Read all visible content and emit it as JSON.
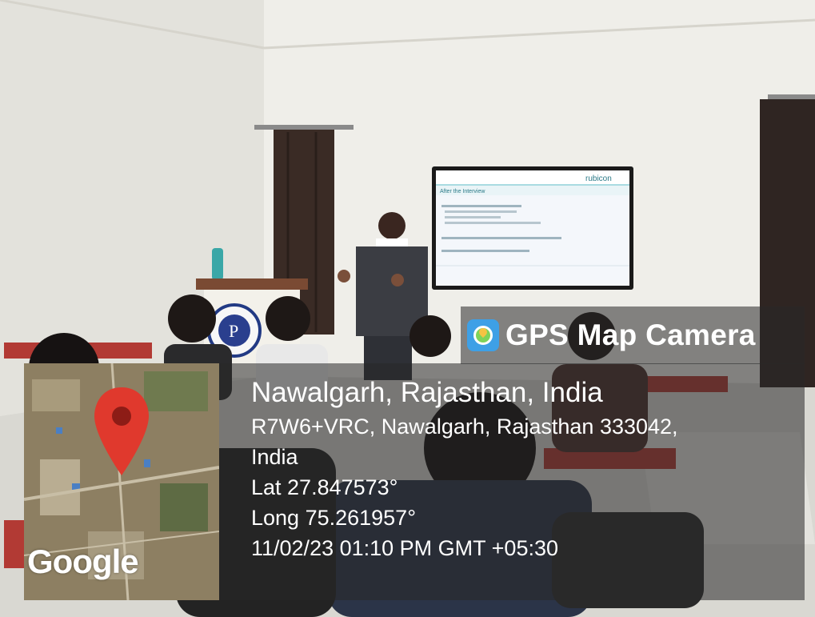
{
  "slide": {
    "brand": "rubicon",
    "title": "After the Interview"
  },
  "podium": {
    "logo_letter": "P"
  },
  "stamp": {
    "app_name": "GPS Map Camera",
    "place": "Nawalgarh, Rajasthan, India",
    "address_line1": "R7W6+VRC, Nawalgarh, Rajasthan 333042,",
    "address_line2": "India",
    "latitude": "Lat 27.847573°",
    "longitude": "Long 75.261957°",
    "datetime": "11/02/23 01:10 PM GMT +05:30",
    "map_watermark": "Google"
  }
}
